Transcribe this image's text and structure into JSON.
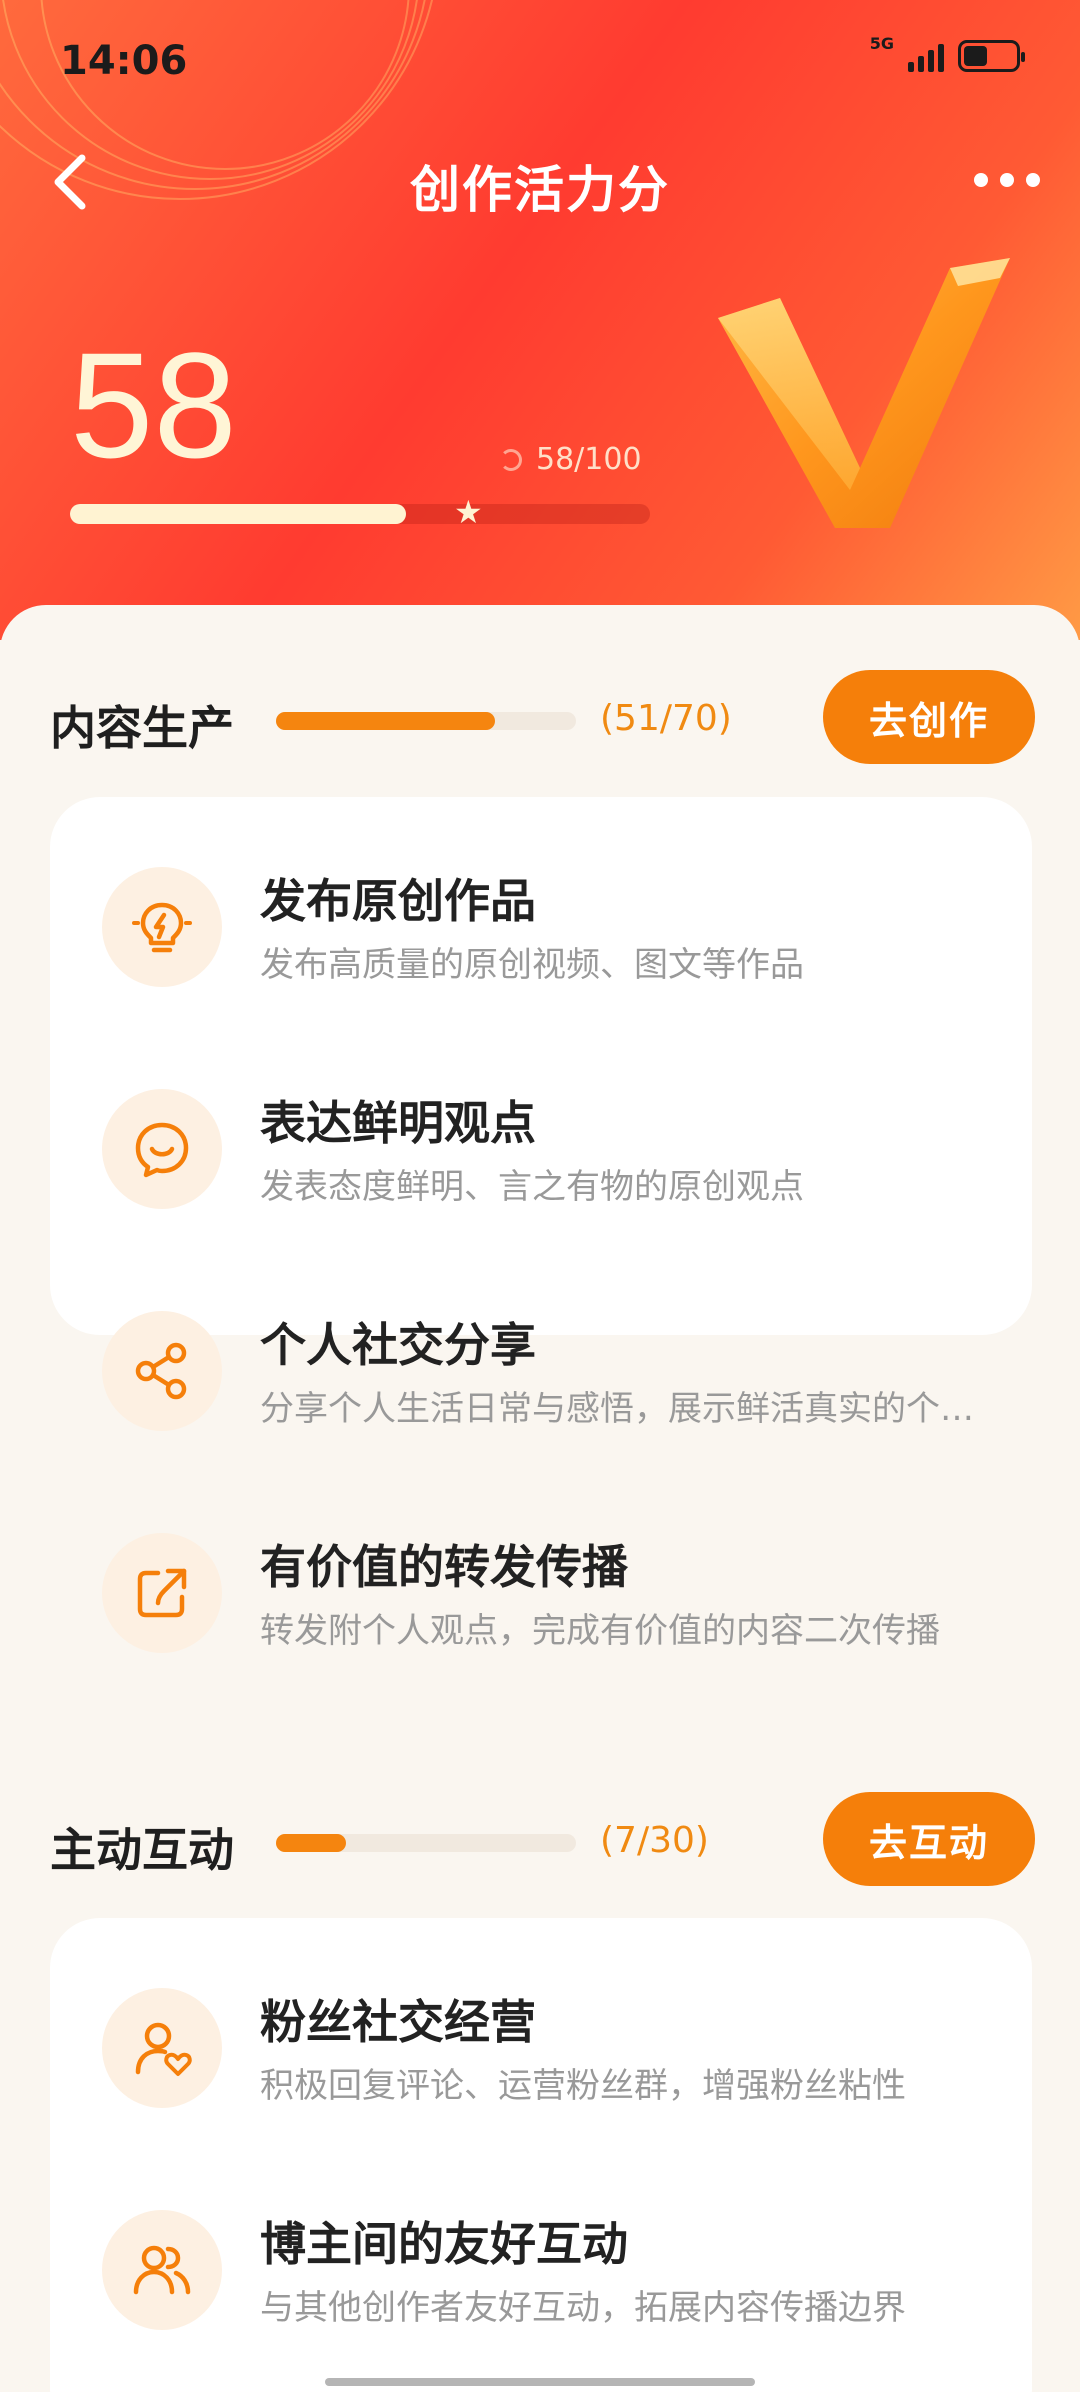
{
  "status_bar": {
    "time": "14:06",
    "network": "5G",
    "battery_level": 0.45
  },
  "header": {
    "title": "创作活力分"
  },
  "score": {
    "value": "58",
    "ratio_text": "58/100",
    "progress": 0.58
  },
  "sections": [
    {
      "title": "内容生产",
      "count_text": "(51/70)",
      "progress": 0.7286,
      "button_label": "去创作",
      "items": [
        {
          "title": "发布原创作品",
          "desc": "发布高质量的原创视频、图文等作品",
          "icon": "lightbulb-icon"
        },
        {
          "title": "表达鲜明观点",
          "desc": "发表态度鲜明、言之有物的原创观点",
          "icon": "chat-smile-icon"
        },
        {
          "title": "个人社交分享",
          "desc": "分享个人生活日常与感悟，展示鲜活真实的个人形象",
          "icon": "share-icon"
        },
        {
          "title": "有价值的转发传播",
          "desc": "转发附个人观点，完成有价值的内容二次传播",
          "icon": "forward-icon"
        }
      ]
    },
    {
      "title": "主动互动",
      "count_text": "(7/30)",
      "progress": 0.2333,
      "button_label": "去互动",
      "items": [
        {
          "title": "粉丝社交经营",
          "desc": "积极回复评论、运营粉丝群，增强粉丝粘性",
          "icon": "fan-heart-icon"
        },
        {
          "title": "博主间的友好互动",
          "desc": "与其他创作者友好互动，拓展内容传播边界",
          "icon": "users-icon"
        }
      ]
    }
  ],
  "colors": {
    "accent": "#f57f0a",
    "hero_red": "#ff3b30",
    "score_text": "#fff5d6",
    "icon_bg": "#fdf0e2"
  }
}
